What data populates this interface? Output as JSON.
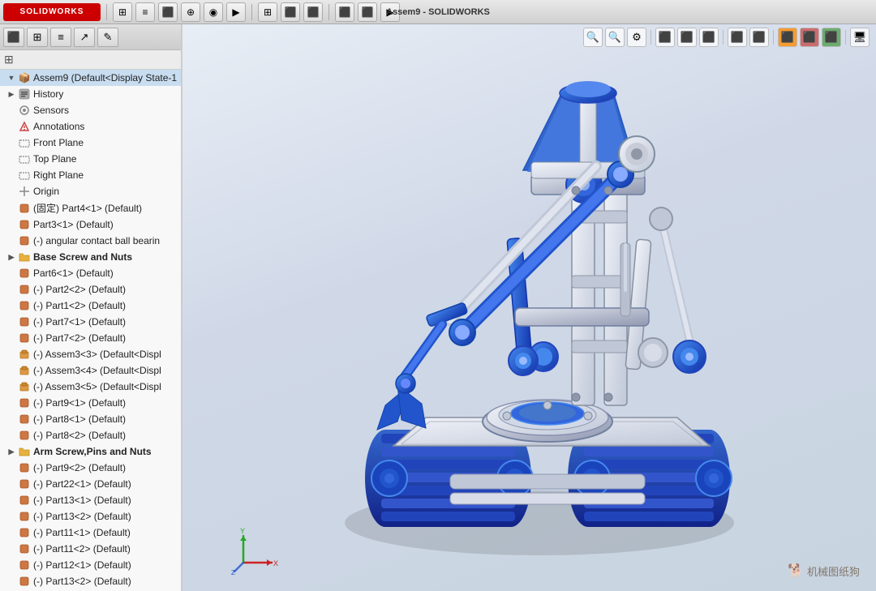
{
  "app": {
    "title": "Assem9 - SOLIDWORKS",
    "logo": "SOLIDWORKS"
  },
  "toolbar": {
    "buttons": [
      "⊞",
      "≡",
      "⬛",
      "⊕",
      "⬤",
      "▶"
    ]
  },
  "left_panel": {
    "tabs": [
      "⬛",
      "⊞",
      "≡",
      "↗",
      "✎"
    ],
    "filter_placeholder": "Filter",
    "root_item": {
      "label": "Assem9 (Default<Display State-1",
      "icon": "📦"
    },
    "tree_items": [
      {
        "id": "history",
        "label": "History",
        "icon": "📋",
        "indent": 1,
        "expandable": true,
        "type": "special"
      },
      {
        "id": "sensors",
        "label": "Sensors",
        "icon": "📡",
        "indent": 1,
        "expandable": false,
        "type": "special"
      },
      {
        "id": "annotations",
        "label": "Annotations",
        "icon": "📝",
        "indent": 1,
        "expandable": false,
        "type": "special"
      },
      {
        "id": "front-plane",
        "label": "Front Plane",
        "icon": "▭",
        "indent": 1,
        "expandable": false,
        "type": "plane"
      },
      {
        "id": "top-plane",
        "label": "Top Plane",
        "icon": "▭",
        "indent": 1,
        "expandable": false,
        "type": "plane"
      },
      {
        "id": "right-plane",
        "label": "Right Plane",
        "icon": "▭",
        "indent": 1,
        "expandable": false,
        "type": "plane"
      },
      {
        "id": "origin",
        "label": "Origin",
        "icon": "✛",
        "indent": 1,
        "expandable": false,
        "type": "origin"
      },
      {
        "id": "part4",
        "label": "(固定) Part4<1> (Default)",
        "icon": "🔩",
        "indent": 1,
        "expandable": false,
        "type": "part"
      },
      {
        "id": "part3",
        "label": "Part3<1> (Default)",
        "icon": "🔩",
        "indent": 1,
        "expandable": false,
        "type": "part"
      },
      {
        "id": "angular",
        "label": "(-) angular contact ball bearin",
        "icon": "🔩",
        "indent": 1,
        "expandable": false,
        "type": "part"
      },
      {
        "id": "base-screw",
        "label": "Base Screw and Nuts",
        "icon": "📁",
        "indent": 1,
        "expandable": true,
        "type": "folder"
      },
      {
        "id": "part6",
        "label": "Part6<1> (Default)",
        "icon": "🔩",
        "indent": 1,
        "expandable": false,
        "type": "part"
      },
      {
        "id": "part2-2",
        "label": "(-) Part2<2> (Default)",
        "icon": "🔩",
        "indent": 1,
        "expandable": false,
        "type": "part"
      },
      {
        "id": "part1-2",
        "label": "(-) Part1<2> (Default)",
        "icon": "🔩",
        "indent": 1,
        "expandable": false,
        "type": "part"
      },
      {
        "id": "part7-1",
        "label": "(-) Part7<1> (Default)",
        "icon": "🔩",
        "indent": 1,
        "expandable": false,
        "type": "part"
      },
      {
        "id": "part7-2",
        "label": "(-) Part7<2> (Default)",
        "icon": "🔩",
        "indent": 1,
        "expandable": false,
        "type": "part"
      },
      {
        "id": "assem3-3",
        "label": "(-) Assem3<3> (Default<Displ",
        "icon": "📦",
        "indent": 1,
        "expandable": false,
        "type": "assembly"
      },
      {
        "id": "assem3-4",
        "label": "(-) Assem3<4> (Default<Displ",
        "icon": "📦",
        "indent": 1,
        "expandable": false,
        "type": "assembly"
      },
      {
        "id": "assem3-5",
        "label": "(-) Assem3<5> (Default<Displ",
        "icon": "📦",
        "indent": 1,
        "expandable": false,
        "type": "assembly"
      },
      {
        "id": "part9-1",
        "label": "(-) Part9<1> (Default)",
        "icon": "🔩",
        "indent": 1,
        "expandable": false,
        "type": "part"
      },
      {
        "id": "part8-1",
        "label": "(-) Part8<1> (Default)",
        "icon": "🔩",
        "indent": 1,
        "expandable": false,
        "type": "part"
      },
      {
        "id": "part8-2",
        "label": "(-) Part8<2> (Default)",
        "icon": "🔩",
        "indent": 1,
        "expandable": false,
        "type": "part"
      },
      {
        "id": "arm-screw",
        "label": "Arm Screw,Pins and Nuts",
        "icon": "📁",
        "indent": 1,
        "expandable": true,
        "type": "folder"
      },
      {
        "id": "part9-2",
        "label": "(-) Part9<2> (Default)",
        "icon": "🔩",
        "indent": 1,
        "expandable": false,
        "type": "part"
      },
      {
        "id": "part22-1",
        "label": "(-) Part22<1> (Default)",
        "icon": "🔩",
        "indent": 1,
        "expandable": false,
        "type": "part"
      },
      {
        "id": "part13-1",
        "label": "(-) Part13<1> (Default)",
        "icon": "🔩",
        "indent": 1,
        "expandable": false,
        "type": "part"
      },
      {
        "id": "part13-2",
        "label": "(-) Part13<2> (Default)",
        "icon": "🔩",
        "indent": 1,
        "expandable": false,
        "type": "part"
      },
      {
        "id": "part11-1",
        "label": "(-) Part11<1> (Default)",
        "icon": "🔩",
        "indent": 1,
        "expandable": false,
        "type": "part"
      },
      {
        "id": "part11-2",
        "label": "(-) Part11<2> (Default)",
        "icon": "🔩",
        "indent": 1,
        "expandable": false,
        "type": "part"
      },
      {
        "id": "part12-1",
        "label": "(-) Part12<1> (Default)",
        "icon": "🔩",
        "indent": 1,
        "expandable": false,
        "type": "part"
      },
      {
        "id": "part12-2",
        "label": "(-) Part13<2> (Default)",
        "icon": "🔩",
        "indent": 1,
        "expandable": false,
        "type": "part"
      }
    ]
  },
  "viewport_toolbar": {
    "buttons": [
      "🔍",
      "🔍",
      "⚙",
      "⬛",
      "⬛",
      "⬛",
      "⬛",
      "⬛",
      "⬛",
      "⬛",
      "⬛",
      "🖥"
    ]
  },
  "watermark": {
    "text": "机械图纸狗"
  },
  "colors": {
    "robot_blue": "#2255cc",
    "robot_light_gray": "#c8ccd8",
    "robot_dark_gray": "#8890a0",
    "robot_white": "#e8e8ee",
    "background_gradient_start": "#e8eef5",
    "background_gradient_end": "#c8d4e0"
  }
}
